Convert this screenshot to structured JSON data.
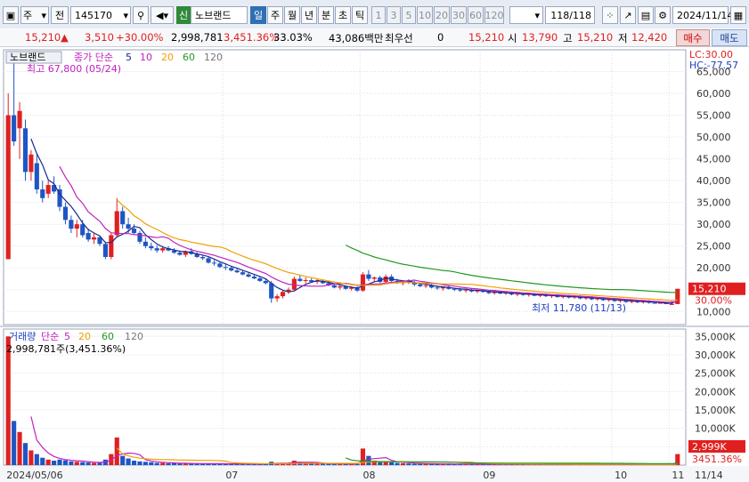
{
  "toolbar": {
    "market": "주",
    "type": "전",
    "code": "145170",
    "market_tag": "신",
    "stock_name": "노브랜드",
    "periods": [
      "일",
      "주",
      "월",
      "년",
      "분",
      "초",
      "틱"
    ],
    "selected_period": "일",
    "minute_units": [
      "1",
      "3",
      "5",
      "10",
      "20",
      "30",
      "60",
      "120"
    ],
    "count": "118",
    "count_total": "/118",
    "date": "2024/11/14"
  },
  "info": {
    "price": "15,210",
    "change": "3,510",
    "change_pct": "+30.00%",
    "volume": "2,998,781",
    "volume_ratio": "3,451.36%",
    "turnover": "33.03%",
    "amount": "43,086백만",
    "share_type": "최우선",
    "zero": "0",
    "open_label": "시",
    "open_value": "15,210",
    "high_label": "고",
    "high_value": "13,790",
    "low_label": "저",
    "low_value": "15,210",
    "close_extra": "12,420",
    "buy": "매수",
    "sell": "매도"
  },
  "colors": {
    "up": "#e02020",
    "down": "#1f55c4",
    "ma5": "#1a2a8c",
    "ma10": "#c020c0",
    "ma20": "#f0a000",
    "ma60": "#229922"
  },
  "price_panel": {
    "title": "노브랜드",
    "legend": [
      {
        "text": "종가 단순",
        "color": "#c020c0"
      },
      {
        "text": "5",
        "color": "#1a2a8c"
      },
      {
        "text": "10",
        "color": "#c020c0"
      },
      {
        "text": "20",
        "color": "#f0a000"
      },
      {
        "text": "60",
        "color": "#229922"
      },
      {
        "text": "120",
        "color": "#777777"
      }
    ],
    "high_note": "최고 67,800 (05/24)",
    "low_note": "최저 11,780 (11/13)",
    "lc": "LC:30.00",
    "hc": "HC:-77.57",
    "current_tag": "15,210",
    "current_pct": "30.00%",
    "y_ticks": [
      "65,000",
      "60,000",
      "55,000",
      "50,000",
      "45,000",
      "40,000",
      "35,000",
      "30,000",
      "25,000",
      "20,000",
      "15,000",
      "10,000"
    ]
  },
  "volume_panel": {
    "legend": [
      {
        "text": "거래량",
        "color": "#1f3fc1"
      },
      {
        "text": "단순",
        "color": "#c020c0"
      },
      {
        "text": "5",
        "color": "#c020c0"
      },
      {
        "text": "20",
        "color": "#f0a000"
      },
      {
        "text": "60",
        "color": "#229922"
      },
      {
        "text": "120",
        "color": "#777777"
      }
    ],
    "current_note": "2,998,781주(3,451.36%)",
    "current_tag": "2,999K",
    "current_pct": "3451.36%",
    "y_ticks": [
      "35,000K",
      "30,000K",
      "25,000K",
      "20,000K",
      "15,000K",
      "10,000K",
      "5,000K"
    ]
  },
  "x_axis": {
    "labels": [
      "2024/05/06",
      "07",
      "08",
      "09",
      "10",
      "11",
      "11/14"
    ]
  },
  "chart_data": {
    "type": "candlestick",
    "price_ylim": [
      7000,
      70000
    ],
    "volume_ylim": [
      0,
      37000
    ],
    "candles": [
      [
        22000,
        60000,
        25000,
        55000,
        35000
      ],
      [
        55000,
        67800,
        48000,
        49000,
        12000
      ],
      [
        52000,
        58000,
        45000,
        56000,
        9000
      ],
      [
        52000,
        54000,
        40000,
        42000,
        6000
      ],
      [
        42000,
        47000,
        40000,
        46000,
        4000
      ],
      [
        44000,
        46000,
        37000,
        38000,
        3000
      ],
      [
        38000,
        40000,
        35000,
        36000,
        2000
      ],
      [
        37000,
        40000,
        36000,
        39000,
        1500
      ],
      [
        39000,
        41000,
        37000,
        37500,
        1200
      ],
      [
        38000,
        39000,
        33000,
        34000,
        1500
      ],
      [
        34000,
        35000,
        30000,
        31000,
        1300
      ],
      [
        31000,
        32000,
        28000,
        29000,
        1000
      ],
      [
        29000,
        31000,
        27000,
        30000,
        900
      ],
      [
        30000,
        31000,
        27000,
        27500,
        800
      ],
      [
        28000,
        29000,
        26000,
        26500,
        700
      ],
      [
        26500,
        28000,
        25500,
        27000,
        600
      ],
      [
        27000,
        27500,
        25000,
        25500,
        600
      ],
      [
        25500,
        26000,
        22000,
        22500,
        1500
      ],
      [
        22500,
        28000,
        22000,
        27500,
        3000
      ],
      [
        27500,
        36000,
        27000,
        33000,
        7500
      ],
      [
        33000,
        34000,
        29000,
        30000,
        2500
      ],
      [
        30000,
        31500,
        28000,
        29000,
        1800
      ],
      [
        29000,
        30000,
        27500,
        28000,
        1200
      ],
      [
        28000,
        28500,
        25500,
        26000,
        1000
      ],
      [
        26000,
        27000,
        24500,
        25000,
        900
      ],
      [
        25000,
        25800,
        24000,
        24500,
        800
      ],
      [
        24500,
        25200,
        23500,
        24000,
        600
      ],
      [
        24000,
        25000,
        23500,
        24500,
        600
      ],
      [
        24500,
        25000,
        23800,
        24000,
        500
      ],
      [
        24000,
        24500,
        23200,
        23500,
        500
      ],
      [
        23500,
        24000,
        22800,
        23000,
        450
      ],
      [
        23000,
        24000,
        22500,
        23800,
        450
      ],
      [
        23800,
        24500,
        23000,
        23200,
        400
      ],
      [
        23200,
        23600,
        22300,
        22500,
        400
      ],
      [
        22500,
        23000,
        21800,
        22200,
        400
      ],
      [
        22200,
        22500,
        21000,
        21200,
        400
      ],
      [
        21200,
        21800,
        20500,
        21000,
        350
      ],
      [
        21000,
        21500,
        20000,
        20200,
        350
      ],
      [
        20200,
        20800,
        19500,
        20000,
        350
      ],
      [
        20000,
        20500,
        19200,
        19400,
        300
      ],
      [
        19400,
        20000,
        18800,
        19000,
        300
      ],
      [
        19000,
        19500,
        18300,
        18500,
        300
      ],
      [
        18500,
        19000,
        17800,
        18000,
        300
      ],
      [
        18000,
        18600,
        17400,
        17600,
        300
      ],
      [
        17600,
        18000,
        16800,
        17000,
        300
      ],
      [
        17000,
        17500,
        16200,
        16500,
        300
      ],
      [
        16500,
        17000,
        12000,
        13000,
        900
      ],
      [
        13000,
        14000,
        12200,
        13500,
        600
      ],
      [
        13500,
        15000,
        13000,
        14500,
        500
      ],
      [
        14500,
        15500,
        14000,
        15000,
        500
      ],
      [
        15000,
        18000,
        14800,
        17500,
        1200
      ],
      [
        17500,
        18500,
        16800,
        17000,
        900
      ],
      [
        17000,
        17800,
        16500,
        17200,
        600
      ],
      [
        17200,
        17600,
        16600,
        16800,
        500
      ],
      [
        16800,
        17400,
        16300,
        17000,
        400
      ],
      [
        17000,
        17300,
        16300,
        16500,
        400
      ],
      [
        16500,
        17000,
        15800,
        16000,
        400
      ],
      [
        16000,
        16500,
        15300,
        15500,
        350
      ],
      [
        15500,
        16200,
        15000,
        15800,
        350
      ],
      [
        15800,
        16000,
        15000,
        15200,
        300
      ],
      [
        15200,
        15800,
        14800,
        15500,
        300
      ],
      [
        15500,
        15800,
        14500,
        14800,
        300
      ],
      [
        14800,
        19000,
        14500,
        18500,
        4500
      ],
      [
        18500,
        19500,
        17000,
        17500,
        2500
      ],
      [
        17500,
        18000,
        16800,
        17800,
        1200
      ],
      [
        17800,
        18200,
        16500,
        16800,
        900
      ],
      [
        16800,
        18500,
        16500,
        18000,
        1100
      ],
      [
        18000,
        18500,
        16800,
        17000,
        800
      ],
      [
        17000,
        17500,
        16300,
        16500,
        600
      ],
      [
        16500,
        17200,
        16000,
        17000,
        500
      ],
      [
        17000,
        17400,
        16300,
        16600,
        450
      ],
      [
        16600,
        17000,
        15800,
        16200,
        400
      ],
      [
        16200,
        16600,
        15600,
        15800,
        350
      ],
      [
        15800,
        16400,
        15400,
        16000,
        350
      ],
      [
        16000,
        16300,
        15300,
        15500,
        300
      ],
      [
        15500,
        16000,
        15000,
        15300,
        300
      ],
      [
        15300,
        15800,
        14800,
        15600,
        300
      ],
      [
        15600,
        15900,
        15000,
        15200,
        300
      ],
      [
        15200,
        15500,
        14700,
        15000,
        280
      ],
      [
        15000,
        15400,
        14500,
        14800,
        280
      ],
      [
        14800,
        15200,
        14300,
        15000,
        280
      ],
      [
        15000,
        15300,
        14400,
        14600,
        260
      ],
      [
        14600,
        15000,
        14200,
        14800,
        260
      ],
      [
        14800,
        15100,
        14300,
        14500,
        250
      ],
      [
        14500,
        14800,
        14000,
        14200,
        250
      ],
      [
        14200,
        14700,
        13900,
        14500,
        250
      ],
      [
        14500,
        14800,
        14000,
        14100,
        240
      ],
      [
        14100,
        14500,
        13800,
        14300,
        240
      ],
      [
        14300,
        14600,
        13700,
        13900,
        230
      ],
      [
        13900,
        14300,
        13500,
        14100,
        230
      ],
      [
        14100,
        14400,
        13600,
        13800,
        220
      ],
      [
        13800,
        14200,
        13400,
        14000,
        220
      ],
      [
        14000,
        14300,
        13500,
        13600,
        210
      ],
      [
        13600,
        14000,
        13300,
        13800,
        210
      ],
      [
        13800,
        14100,
        13300,
        13500,
        200
      ],
      [
        13500,
        13900,
        13100,
        13700,
        200
      ],
      [
        13700,
        14000,
        13200,
        13300,
        200
      ],
      [
        13300,
        13700,
        13000,
        13500,
        200
      ],
      [
        13500,
        13800,
        13000,
        13200,
        190
      ],
      [
        13200,
        13600,
        12900,
        13400,
        190
      ],
      [
        13400,
        13700,
        12800,
        13000,
        180
      ],
      [
        13000,
        13400,
        12700,
        13200,
        180
      ],
      [
        13200,
        13500,
        12600,
        12800,
        180
      ],
      [
        12800,
        13200,
        12500,
        13000,
        170
      ],
      [
        13000,
        13300,
        12400,
        12600,
        170
      ],
      [
        12600,
        13000,
        12300,
        12800,
        160
      ],
      [
        12800,
        13100,
        12200,
        12400,
        160
      ],
      [
        12400,
        12800,
        12100,
        12600,
        160
      ],
      [
        12600,
        12900,
        12000,
        12200,
        150
      ],
      [
        12200,
        12600,
        11900,
        12400,
        150
      ],
      [
        12400,
        12700,
        11900,
        12100,
        150
      ],
      [
        12100,
        12500,
        11800,
        12300,
        150
      ],
      [
        12300,
        12600,
        11800,
        12000,
        150
      ],
      [
        12000,
        12400,
        11780,
        11900,
        160
      ],
      [
        11900,
        12200,
        11780,
        12000,
        140
      ],
      [
        12000,
        12300,
        11800,
        11700,
        200
      ],
      [
        11700,
        12500,
        11700,
        11700,
        300
      ],
      [
        11700,
        15210,
        11700,
        15210,
        2999
      ]
    ]
  }
}
